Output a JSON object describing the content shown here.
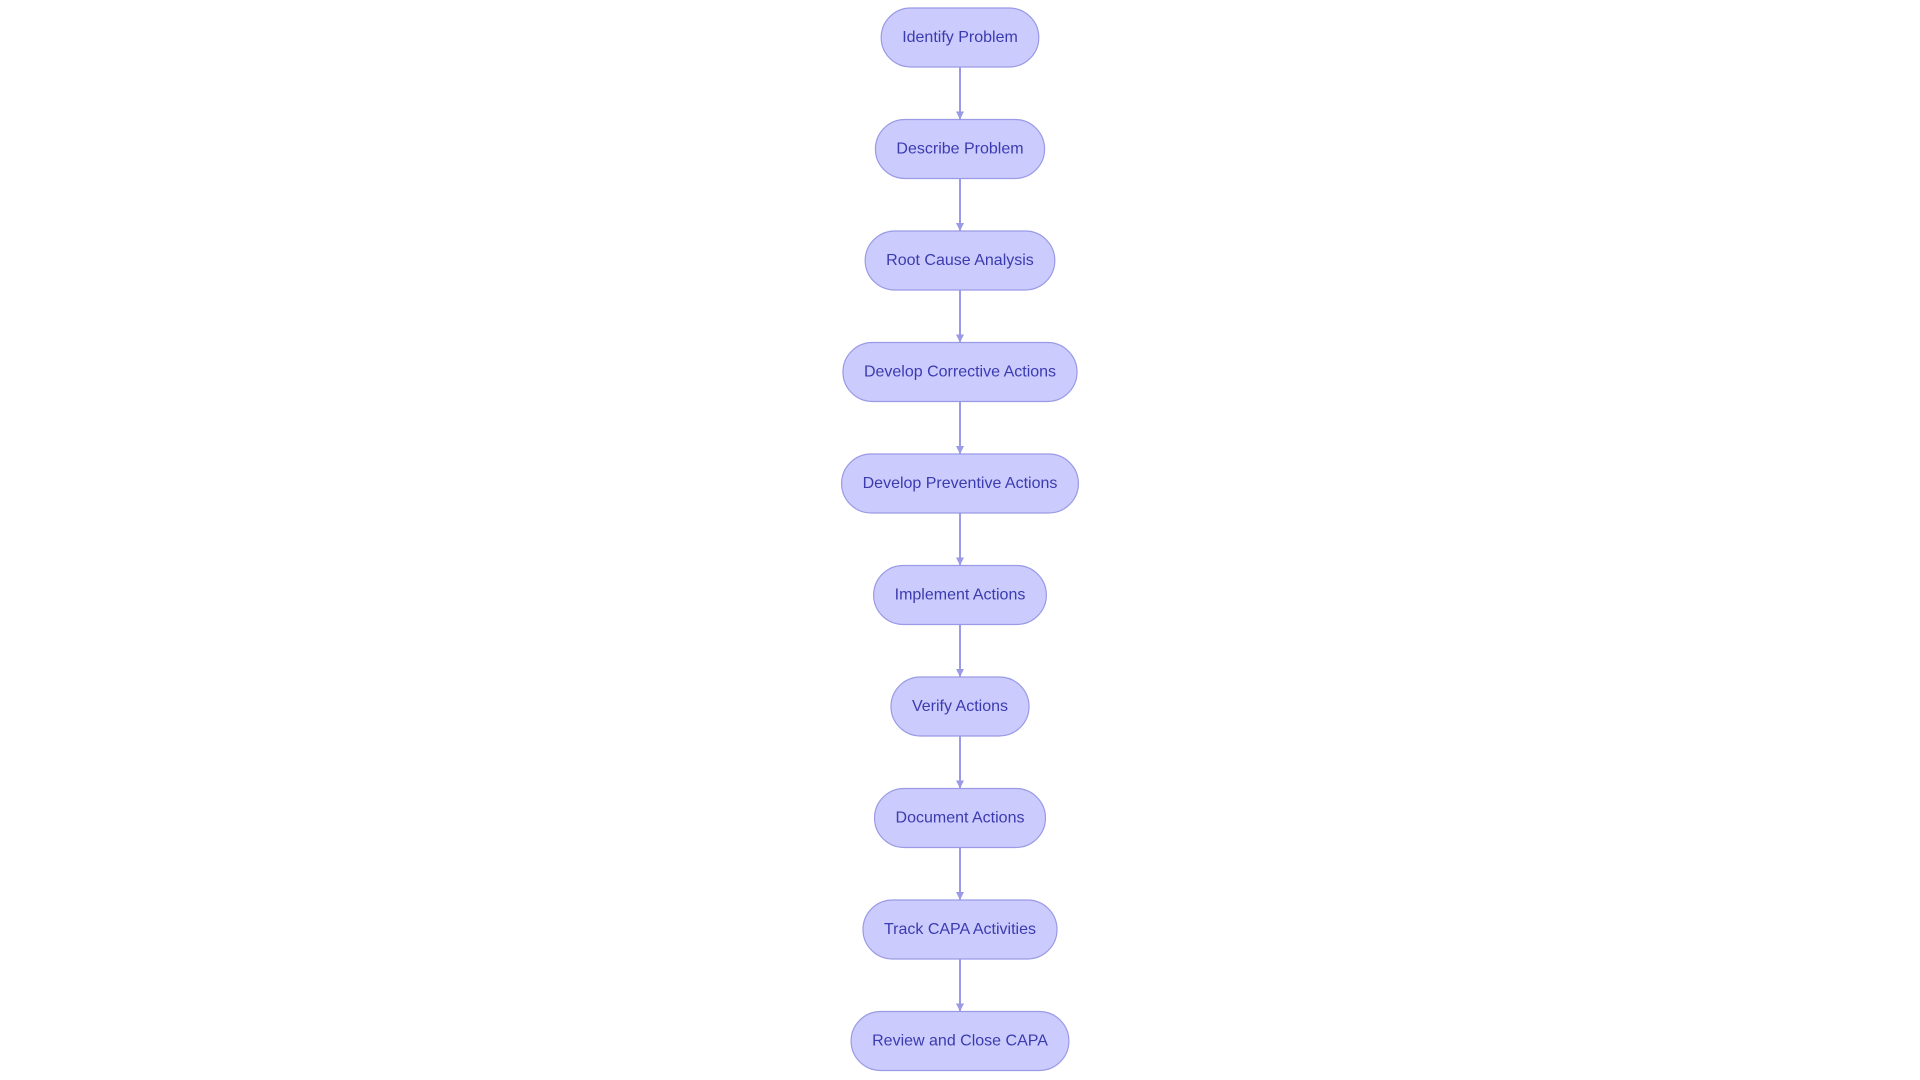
{
  "colors": {
    "node_fill": "#cbcbfd",
    "node_stroke": "#9a9ae6",
    "node_text": "#3b3bb0",
    "edge": "#9a9ae6"
  },
  "flowchart": {
    "direction": "top-to-bottom",
    "nodes": [
      {
        "id": "n1",
        "label": "Identify Problem"
      },
      {
        "id": "n2",
        "label": "Describe Problem"
      },
      {
        "id": "n3",
        "label": "Root Cause Analysis"
      },
      {
        "id": "n4",
        "label": "Develop Corrective Actions"
      },
      {
        "id": "n5",
        "label": "Develop Preventive Actions"
      },
      {
        "id": "n6",
        "label": "Implement Actions"
      },
      {
        "id": "n7",
        "label": "Verify Actions"
      },
      {
        "id": "n8",
        "label": "Document Actions"
      },
      {
        "id": "n9",
        "label": "Track CAPA Activities"
      },
      {
        "id": "n10",
        "label": "Review and Close CAPA"
      }
    ],
    "edges": [
      [
        "n1",
        "n2"
      ],
      [
        "n2",
        "n3"
      ],
      [
        "n3",
        "n4"
      ],
      [
        "n4",
        "n5"
      ],
      [
        "n5",
        "n6"
      ],
      [
        "n6",
        "n7"
      ],
      [
        "n7",
        "n8"
      ],
      [
        "n8",
        "n9"
      ],
      [
        "n9",
        "n10"
      ]
    ]
  }
}
